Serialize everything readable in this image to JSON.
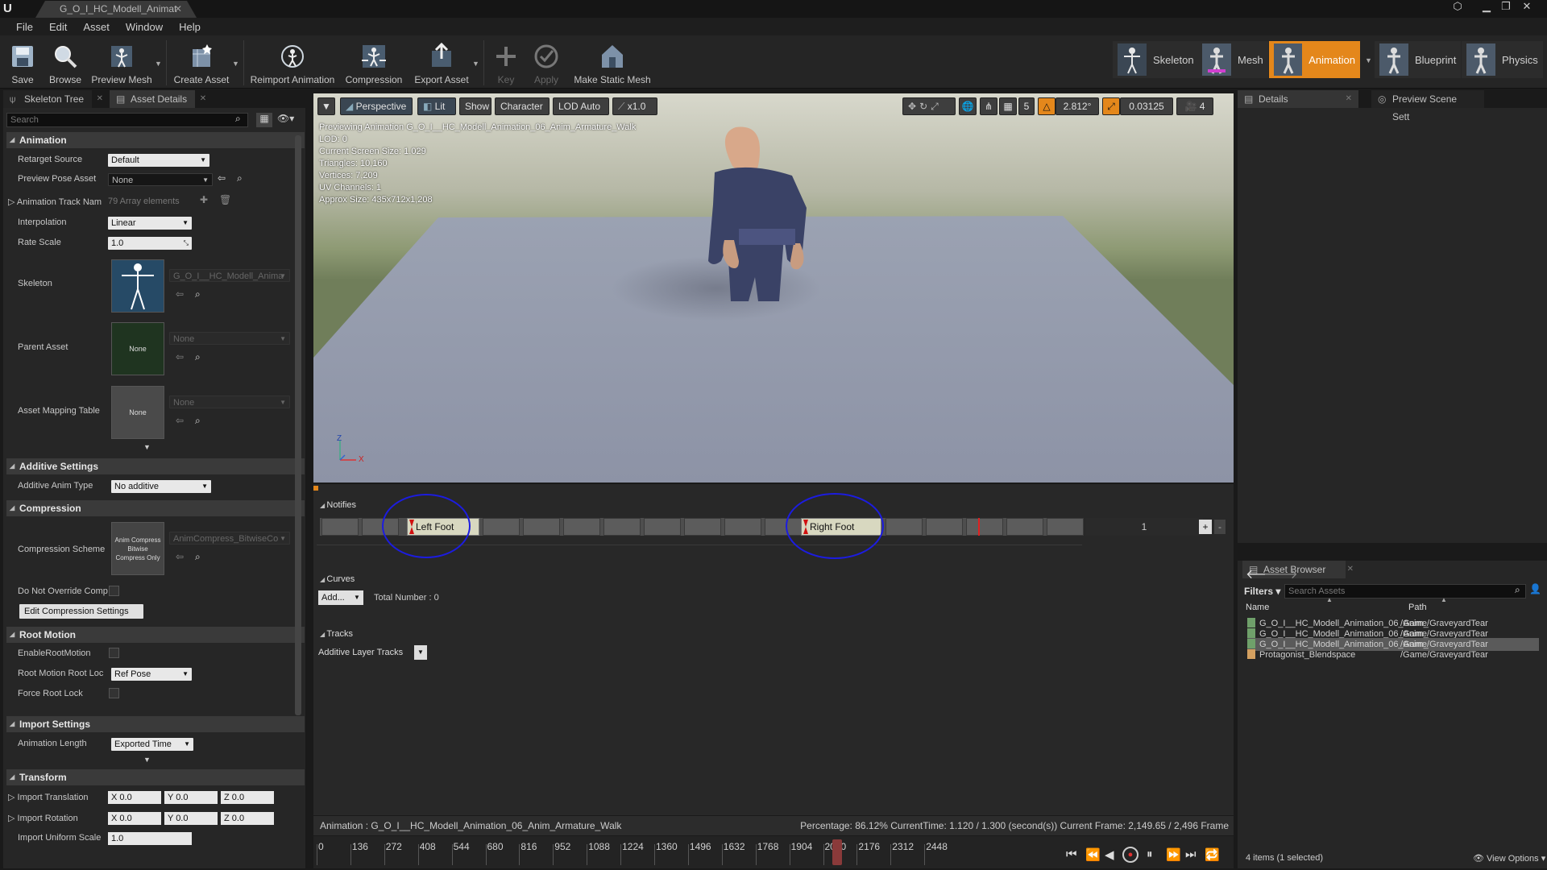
{
  "window": {
    "tab_title": "G_O_I_HC_Modell_Animat",
    "logo": "U"
  },
  "menu": [
    "File",
    "Edit",
    "Asset",
    "Window",
    "Help"
  ],
  "toolbar": {
    "save": "Save",
    "browse": "Browse",
    "preview_mesh": "Preview Mesh",
    "create_asset": "Create Asset",
    "reimport_animation": "Reimport Animation",
    "compression": "Compression",
    "export_asset": "Export Asset",
    "key": "Key",
    "apply": "Apply",
    "make_static_mesh": "Make Static Mesh",
    "modes": {
      "skeleton": "Skeleton",
      "mesh": "Mesh",
      "animation": "Animation",
      "blueprint": "Blueprint",
      "physics": "Physics"
    }
  },
  "left_panel": {
    "tabs": [
      "Skeleton Tree",
      "Asset Details"
    ],
    "search_placeholder": "Search",
    "animation": {
      "header": "Animation",
      "retarget_source_label": "Retarget Source",
      "retarget_source_value": "Default",
      "preview_pose_label": "Preview Pose Asset",
      "preview_pose_value": "None",
      "track_names_label": "Animation Track Nam",
      "track_names_value": "79 Array elements",
      "interpolation_label": "Interpolation",
      "interpolation_value": "Linear",
      "rate_scale_label": "Rate Scale",
      "rate_scale_value": "1.0",
      "skeleton_label": "Skeleton",
      "skeleton_value": "G_O_I__HC_Modell_Anima",
      "parent_asset_label": "Parent Asset",
      "parent_asset_thumb": "None",
      "parent_asset_value": "None",
      "mapping_table_label": "Asset Mapping Table",
      "mapping_table_thumb": "None",
      "mapping_table_value": "None"
    },
    "additive": {
      "header": "Additive Settings",
      "type_label": "Additive Anim Type",
      "type_value": "No additive"
    },
    "compression": {
      "header": "Compression",
      "scheme_label": "Compression Scheme",
      "scheme_thumb": "Anim Compress Bitwise Compress Only",
      "scheme_value": "AnimCompress_BitwiseCo",
      "override_label": "Do Not Override Comp",
      "edit_button": "Edit Compression Settings"
    },
    "root_motion": {
      "header": "Root Motion",
      "enable_label": "EnableRootMotion",
      "lock_label": "Root Motion Root Loc",
      "lock_value": "Ref Pose",
      "force_label": "Force Root Lock"
    },
    "import_settings": {
      "header": "Import Settings",
      "length_label": "Animation Length",
      "length_value": "Exported Time"
    },
    "transform": {
      "header": "Transform",
      "translation_label": "Import Translation",
      "rotation_label": "Import Rotation",
      "uniform_scale_label": "Import Uniform Scale",
      "x": "X  0.0",
      "y": "Y  0.0",
      "z": "Z  0.0",
      "scale_value": "1.0"
    }
  },
  "viewport": {
    "buttons": {
      "perspective": "Perspective",
      "lit": "Lit",
      "show": "Show",
      "character": "Character",
      "lod": "LOD Auto",
      "speed": "x1.0"
    },
    "right_controls": {
      "grid_snap": "5",
      "rotation_snap": "2.812°",
      "scale_snap": "0.03125",
      "camera_speed": "4"
    },
    "info": [
      "Previewing Animation G_O_I__HC_Modell_Animation_06_Anim_Armature_Walk",
      "LOD: 0",
      "Current Screen Size: 1.029",
      "Triangles: 10,160",
      "Vertices: 7,209",
      "UV Channels: 1",
      "Approx Size: 435x712x1,208"
    ],
    "axis": {
      "z": "Z",
      "x": "X"
    }
  },
  "editor": {
    "notifies_header": "Notifies",
    "notify_left": "Left Foot",
    "notify_right": "Right Foot",
    "track_number": "1",
    "curves_header": "Curves",
    "add_button": "Add...",
    "total_number": "Total Number : 0",
    "tracks_header": "Tracks",
    "additive_layer": "Additive Layer Tracks"
  },
  "status": {
    "animation": "Animation :  G_O_I__HC_Modell_Animation_06_Anim_Armature_Walk",
    "progress": "Percentage: 86.12% CurrentTime: 1.120 / 1.300 (second(s)) Current Frame: 2,149.65 / 2,496 Frame"
  },
  "timeline": {
    "ticks": [
      "0",
      "136",
      "272",
      "408",
      "544",
      "680",
      "816",
      "952",
      "1088",
      "1224",
      "1360",
      "1496",
      "1632",
      "1768",
      "1904",
      "2040",
      "2176",
      "2312",
      "2448"
    ],
    "progress_fraction": 0.8612
  },
  "right_panel": {
    "tabs": [
      "Details",
      "Preview Scene Sett"
    ],
    "asset_browser_tab": "Asset Browser",
    "filters": "Filters",
    "search_placeholder": "Search Assets",
    "col_name": "Name",
    "col_path": "Path",
    "rows": [
      {
        "name": "G_O_I__HC_Modell_Animation_06_Anim_",
        "path": "/Game/GraveyardTear",
        "selected": false
      },
      {
        "name": "G_O_I__HC_Modell_Animation_06_Anim_",
        "path": "/Game/GraveyardTear",
        "selected": false
      },
      {
        "name": "G_O_I__HC_Modell_Animation_06_Anim_",
        "path": "/Game/GraveyardTear",
        "selected": true
      },
      {
        "name": "Protagonist_Blendspace",
        "path": "/Game/GraveyardTear",
        "selected": false
      }
    ],
    "items_count": "4 items (1 selected)",
    "view_options": "View Options"
  },
  "colors": {
    "accent_orange": "#e4871b",
    "annotation_blue": "#1c1ce0",
    "notify_marker_red": "#d01010"
  }
}
